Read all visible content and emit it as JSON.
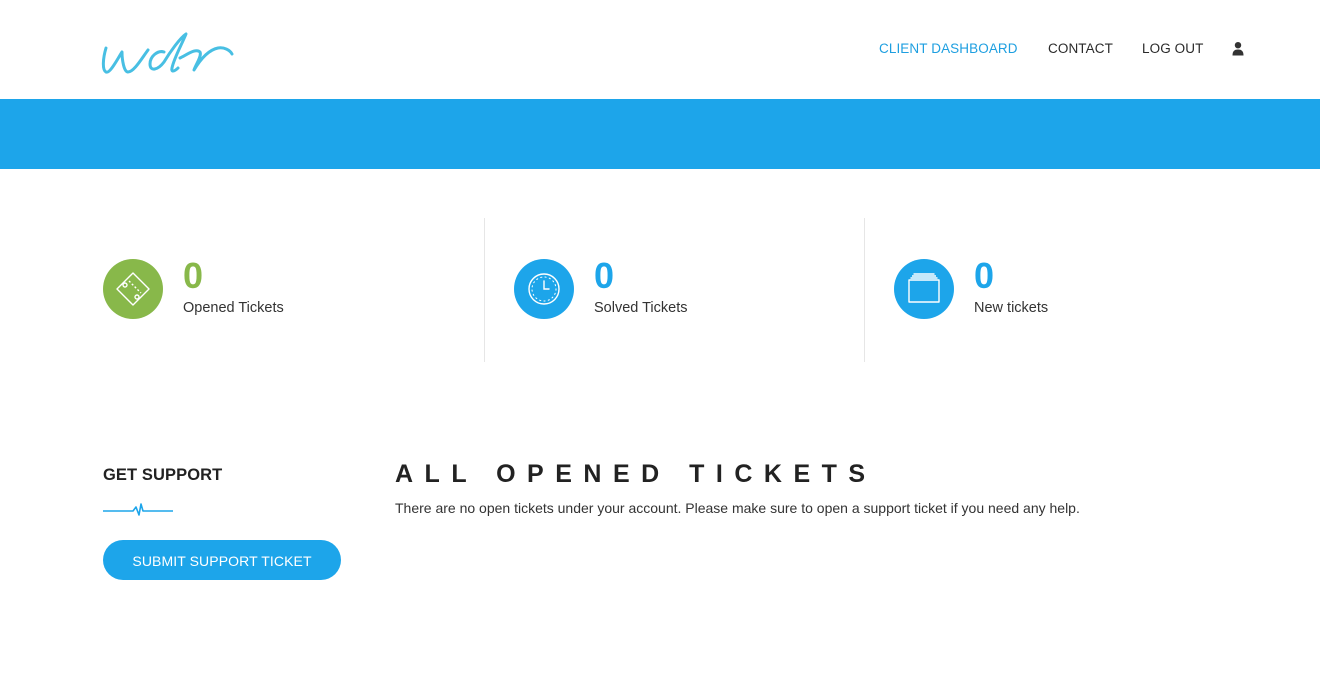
{
  "header": {
    "logo_text": "wdr",
    "nav": {
      "dashboard": "CLIENT DASHBOARD",
      "contact": "CONTACT",
      "logout": "LOG OUT"
    },
    "user_icon": "user-icon"
  },
  "stats": [
    {
      "count": "0",
      "label": "Opened Tickets",
      "icon": "ticket-icon",
      "color": "#88b84a"
    },
    {
      "count": "0",
      "label": "Solved Tickets",
      "icon": "clock-icon",
      "color": "#1da5ea"
    },
    {
      "count": "0",
      "label": "New tickets",
      "icon": "stack-icon",
      "color": "#1da5ea"
    }
  ],
  "support": {
    "title": "GET SUPPORT",
    "button": "SUBMIT SUPPORT TICKET"
  },
  "tickets": {
    "title": "ALL OPENED TICKETS",
    "message": "There are no open tickets under your account. Please make sure to open a support ticket if you need any help."
  },
  "colors": {
    "accent": "#1da5ea",
    "green": "#88b84a",
    "nav_active": "#1e9fe0"
  }
}
